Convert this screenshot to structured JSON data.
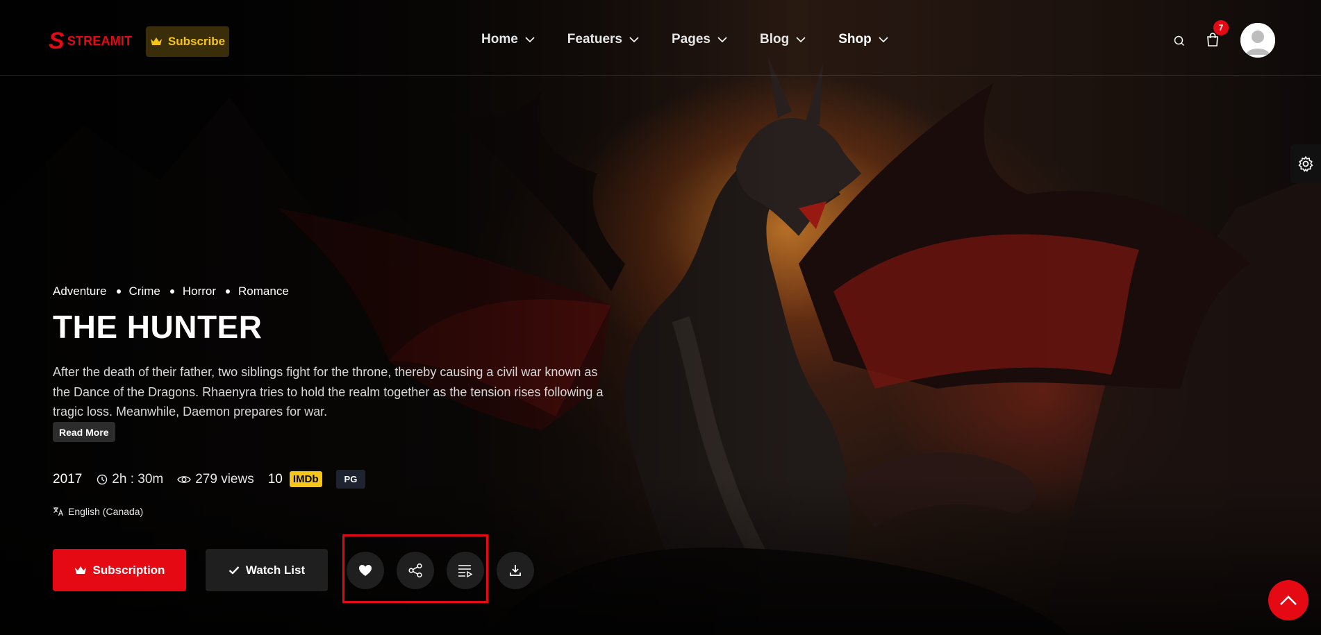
{
  "brand": {
    "logo_letter": "S",
    "name": "STREAMIT"
  },
  "header": {
    "subscribe_label": "Subscribe",
    "nav": [
      {
        "label": "Home"
      },
      {
        "label": "Featuers"
      },
      {
        "label": "Pages"
      },
      {
        "label": "Blog"
      },
      {
        "label": "Shop"
      }
    ],
    "cart_count": "7"
  },
  "movie": {
    "genres": [
      "Adventure",
      "Crime",
      "Horror",
      "Romance"
    ],
    "title": "THE HUNTER",
    "description": "After the death of their father, two siblings fight for the throne, thereby causing a civil war known as the Dance of the Dragons. Rhaenyra tries to hold the realm together as the tension rises following a tragic loss. Meanwhile, Daemon prepares for war.",
    "read_more": "Read More",
    "year": "2017",
    "duration": "2h : 30m",
    "views": "279 views",
    "rating": "10",
    "imdb_label": "IMDb",
    "age_rating": "PG",
    "language": "English (Canada)"
  },
  "actions": {
    "subscription_label": "Subscription",
    "watchlist_label": "Watch List"
  },
  "icons": {
    "actions": [
      "heart-icon",
      "share-icon",
      "playlist-icon",
      "download-icon"
    ],
    "header": [
      "search-icon",
      "cart-icon",
      "avatar"
    ],
    "side": "gear-icon",
    "back_to_top": "chevron-up-icon"
  },
  "colors": {
    "accent": "#e50914",
    "gold": "#f5c518",
    "dark_button": "#1f1f1f"
  }
}
